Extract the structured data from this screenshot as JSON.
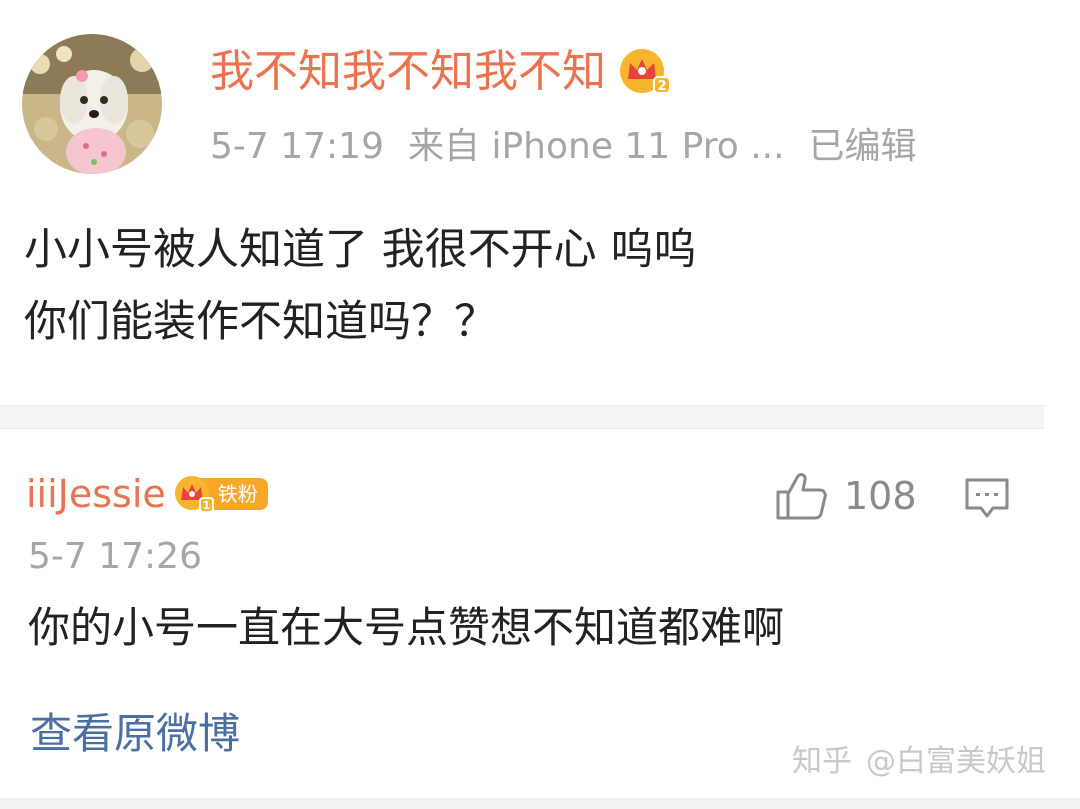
{
  "post": {
    "username": "我不知我不知我不知",
    "badge_icon": "crown-vip-icon",
    "timestamp": "5-7 17:19",
    "source": "来自 iPhone 11 Pro ...",
    "edited": "已编辑",
    "content_lines": [
      "小小号被人知道了 我很不开心 呜呜",
      "你们能装作不知道吗？？"
    ]
  },
  "comment": {
    "username": "iiiJessie",
    "fan_badge_label": "铁粉",
    "fan_badge_level": "1",
    "like_icon": "thumbs-up-icon",
    "like_count": "108",
    "reply_icon": "comment-icon",
    "timestamp": "5-7 17:26",
    "text": "你的小号一直在大号点赞想不知道都难啊"
  },
  "footer": {
    "view_original": "查看原微博"
  },
  "watermark": {
    "platform": "知乎",
    "author": "@白富美妖姐"
  },
  "colors": {
    "username": "#eb7350",
    "meta": "#a6a6a6",
    "link": "#4a6fa5",
    "badge": "#f7a829"
  }
}
